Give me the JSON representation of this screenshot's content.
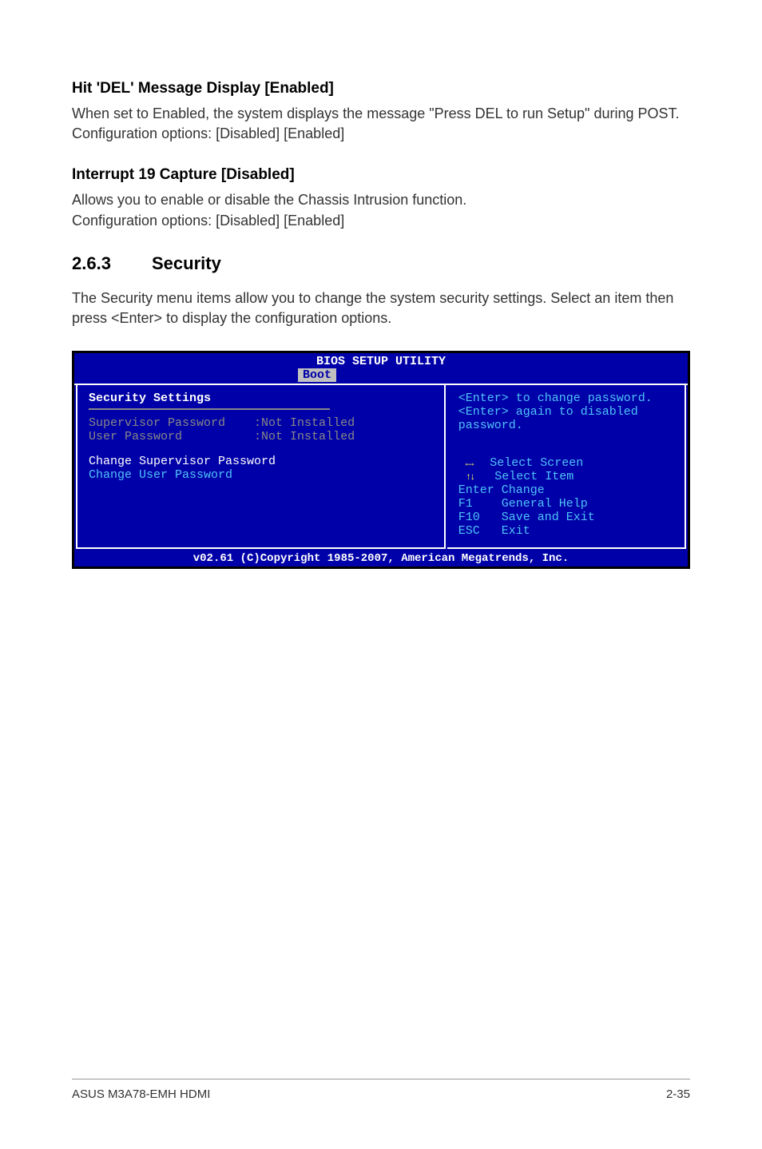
{
  "section1": {
    "heading": "Hit 'DEL' Message Display [Enabled]",
    "body": "When set to Enabled, the system displays the message \"Press DEL to run Setup\" during POST. Configuration options: [Disabled] [Enabled]"
  },
  "section2": {
    "heading": "Interrupt 19 Capture [Disabled]",
    "body": "Allows you to enable or disable the Chassis Intrusion function.\nConfiguration options: [Disabled] [Enabled]"
  },
  "section3": {
    "num": "2.6.3",
    "title": "Security",
    "body": "The Security menu items allow you to change the system security settings. Select an item then press <Enter> to display the configuration options."
  },
  "bios": {
    "title": "BIOS SETUP UTILITY",
    "tab": "Boot",
    "left": {
      "heading": "Security Settings",
      "sup_label": "Supervisor Password",
      "sup_val": ":Not Installed",
      "user_label": "User Password",
      "user_val": ":Not Installed",
      "change_sup": "Change Supervisor Password",
      "change_user": "Change User Password"
    },
    "right": {
      "help1": "<Enter> to change password.",
      "help2": "<Enter> again to disabled password.",
      "nav_screen": "Select Screen",
      "nav_item": "Select Item",
      "nav_enter": "Enter Change",
      "nav_f1": "F1    General Help",
      "nav_f10": "F10   Save and Exit",
      "nav_esc": "ESC   Exit"
    },
    "footer": "v02.61 (C)Copyright 1985-2007, American Megatrends, Inc."
  },
  "footer": {
    "left": "ASUS M3A78-EMH HDMI",
    "right": "2-35"
  }
}
